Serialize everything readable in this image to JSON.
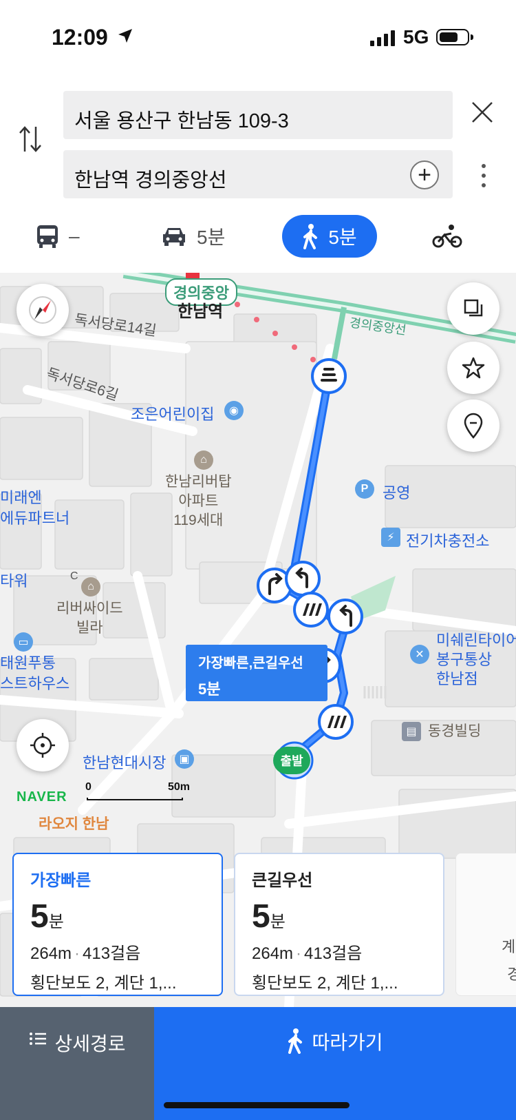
{
  "status": {
    "time": "12:09",
    "network": "5G"
  },
  "search": {
    "origin": "서울 용산구 한남동 109-3",
    "destination": "한남역 경의중앙선"
  },
  "modes": [
    {
      "icon": "bus-icon",
      "label": "–"
    },
    {
      "icon": "car-icon",
      "label": "5분"
    },
    {
      "icon": "walk-icon",
      "label": "5분",
      "selected": true
    },
    {
      "icon": "bike-icon",
      "label": ""
    }
  ],
  "map": {
    "station_badge": "경의중앙",
    "station_name": "한남역",
    "labels": {
      "dokseodang14": "독서당로14길",
      "dokseodang6": "독서당로6길",
      "line": "경의중앙선",
      "daycare": "조은어린이집",
      "apt1": "한남리버탑",
      "apt2": "아파트",
      "apt3": "119세대",
      "parking": "공영",
      "ev": "전기차충전소",
      "mirae1": "미래엔",
      "mirae2": "에듀파트너",
      "tower": "타워",
      "c_letter": "C",
      "villa1": "리버싸이드",
      "villa2": "빌라",
      "guest1": "태원푸통",
      "guest2": "스트하우스",
      "tire1": "미쉐린타이어",
      "tire2": "봉구통상",
      "tire3": "한남점",
      "building": "동경빌딩",
      "market": "한남현대시장",
      "cut": "라오지 한남"
    },
    "route_tip": {
      "title": "가장빠른,큰길우선",
      "duration": "5분"
    },
    "start_label": "출발",
    "naver": "NAVER",
    "scale": {
      "zero": "0",
      "max": "50m"
    }
  },
  "routes": [
    {
      "label": "가장빠른",
      "minutes": "5",
      "unit": "분",
      "distance": "264m",
      "steps": "413걸음",
      "detail": "횡단보도 2, 계단 1,..."
    },
    {
      "label": "큰길우선",
      "minutes": "5",
      "unit": "분",
      "distance": "264m",
      "steps": "413걸음",
      "detail": "횡단보도 2, 계단 1,..."
    }
  ],
  "route3_cut": {
    "a": "계",
    "b": "경"
  },
  "bottom": {
    "detail_button": "상세경로",
    "follow_button": "따라가기"
  },
  "colors": {
    "accent": "#1d6ef2",
    "route": "#2b7df0",
    "rail": "#6fc9a6",
    "start": "#1ea85b"
  }
}
